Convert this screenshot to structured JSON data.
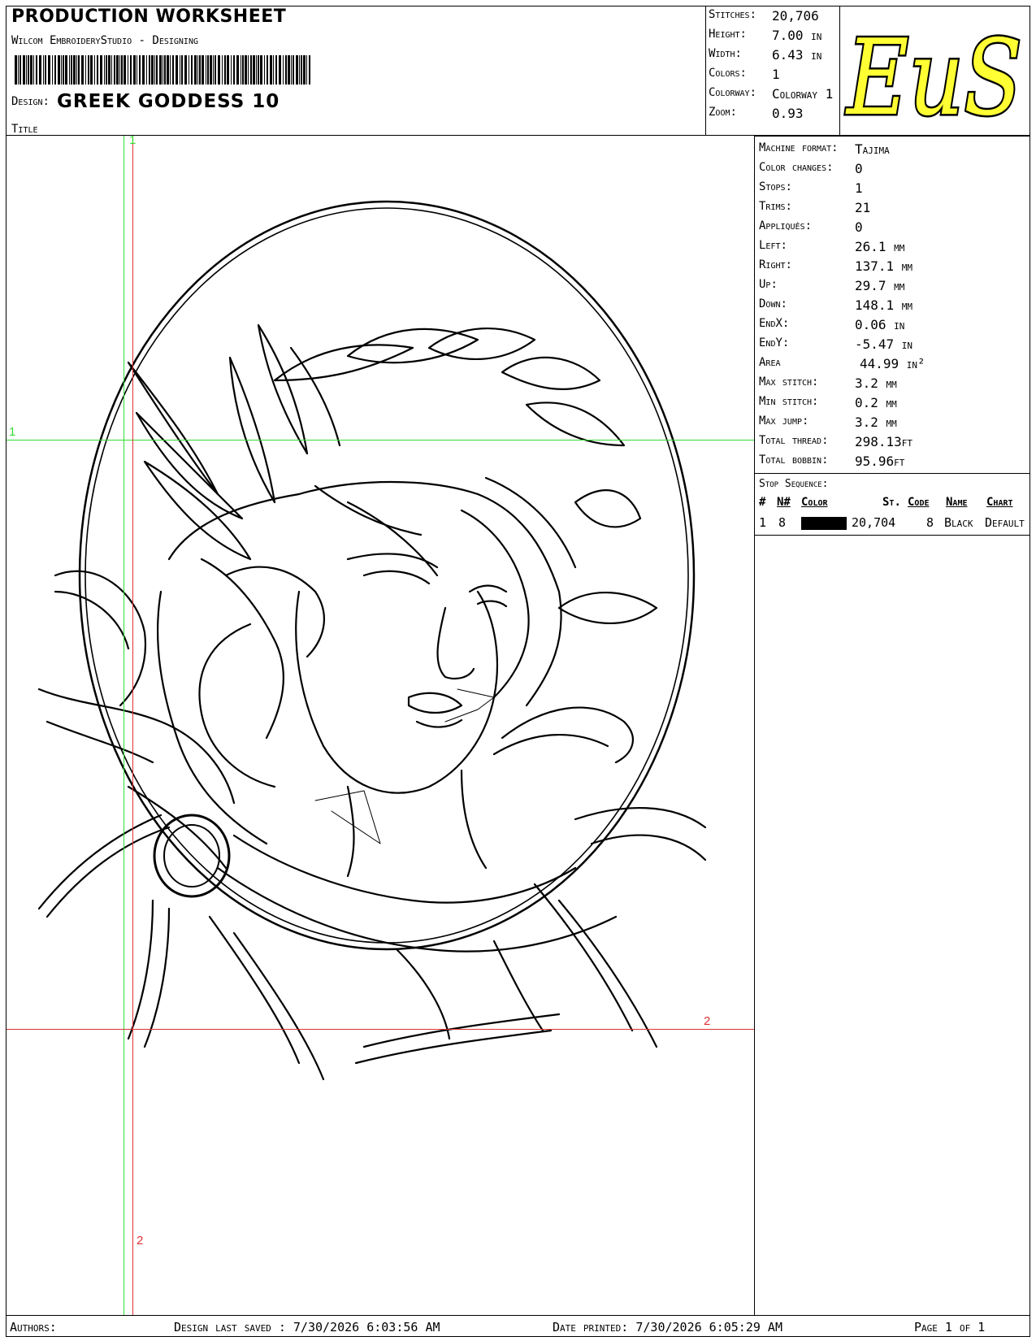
{
  "header": {
    "title": "PRODUCTION WORKSHEET",
    "subtitle": "Wilcom EmbroideryStudio - Designing",
    "design_label": "Design:",
    "design_value": "GREEK GODDESS  10",
    "title_label": "Title"
  },
  "summary": {
    "stitches": {
      "label": "Stitches:",
      "value": "20,706"
    },
    "height": {
      "label": "Height:",
      "value": "7.00 in"
    },
    "width": {
      "label": "Width:",
      "value": "6.43 in"
    },
    "colors": {
      "label": "Colors:",
      "value": "1"
    },
    "colorway": {
      "label": "Colorway:",
      "value": "Colorway 1"
    },
    "zoom": {
      "label": "Zoom:",
      "value": "0.93"
    }
  },
  "logo": {
    "text": "EuS",
    "fill_color": "#ffff33",
    "stroke_color": "#000000"
  },
  "machine_info": {
    "machine_format": {
      "label": "Machine format:",
      "value": "Tajima"
    },
    "color_changes": {
      "label": "Color changes:",
      "value": "0"
    },
    "stops": {
      "label": "Stops:",
      "value": "1"
    },
    "trims": {
      "label": "Trims:",
      "value": "21"
    },
    "appliques": {
      "label": "Appliqués:",
      "value": "0"
    },
    "left": {
      "label": "Left:",
      "value": "26.1 mm"
    },
    "right": {
      "label": "Right:",
      "value": "137.1 mm"
    },
    "up": {
      "label": "Up:",
      "value": "29.7 mm"
    },
    "down": {
      "label": "Down:",
      "value": "148.1 mm"
    },
    "end_x": {
      "label": "EndX:",
      "value": "0.06 in"
    },
    "end_y": {
      "label": "EndY:",
      "value": "-5.47 in"
    },
    "area": {
      "label": "Area",
      "value": "44.99 in²"
    },
    "max_stitch": {
      "label": "Max stitch:",
      "value": "3.2 mm"
    },
    "min_stitch": {
      "label": "Min stitch:",
      "value": "0.2 mm"
    },
    "max_jump": {
      "label": "Max jump:",
      "value": "3.2 mm"
    },
    "total_thread": {
      "label": "Total thread:",
      "value": "298.13ft"
    },
    "total_bobbin": {
      "label": "Total bobbin:",
      "value": "95.96ft"
    }
  },
  "stop_sequence": {
    "title": "Stop Sequence:",
    "columns": [
      "#",
      "N#",
      "Color",
      "St.",
      "Code",
      "Name",
      "Chart"
    ],
    "rows": [
      {
        "num": "1",
        "n": "8",
        "swatch": "#000000",
        "stitches": "20,704",
        "code": "8",
        "name": "Black",
        "chart": "Default"
      }
    ]
  },
  "guides": {
    "v1_label": "1",
    "h1_label": "1",
    "v2_label": "2",
    "h2_label": "2",
    "color_1": "#33dd33",
    "color_2": "#dd3333"
  },
  "footer": {
    "authors_label": "Authors:",
    "last_saved_label": "Design last saved :",
    "last_saved_value": "7/30/2026 6:03:56 AM",
    "printed_label": "Date printed:",
    "printed_value": "7/30/2026 6:05:29 AM",
    "page_label": "Page 1 of 1"
  }
}
